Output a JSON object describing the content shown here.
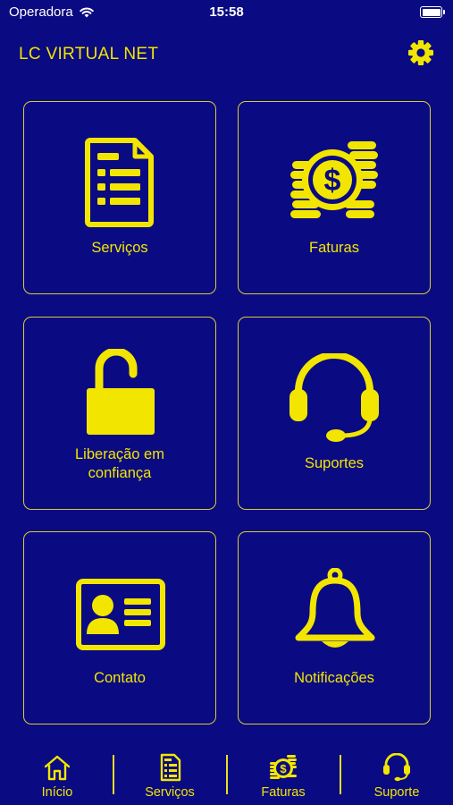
{
  "status_bar": {
    "carrier": "Operadora",
    "time": "15:58"
  },
  "app": {
    "title": "LC VIRTUAL NET"
  },
  "tiles": [
    {
      "label": "Serviços",
      "icon": "document-list-icon"
    },
    {
      "label": "Faturas",
      "icon": "coins-dollar-icon"
    },
    {
      "label_line1": "Liberação em",
      "label_line2": "confiança",
      "icon": "unlocked-padlock-icon"
    },
    {
      "label": "Suportes",
      "icon": "headset-icon"
    },
    {
      "label": "Contato",
      "icon": "contact-card-icon"
    },
    {
      "label": "Notificações",
      "icon": "bell-icon"
    }
  ],
  "tabbar": {
    "items": [
      {
        "label": "Início",
        "icon": "home-icon"
      },
      {
        "label": "Serviços",
        "icon": "document-list-icon"
      },
      {
        "label": "Faturas",
        "icon": "coins-dollar-icon"
      },
      {
        "label": "Suporte",
        "icon": "headset-icon"
      }
    ]
  },
  "colors": {
    "background": "#0a0a82",
    "accent": "#f2e600",
    "tile_border": "#d8cf30"
  }
}
